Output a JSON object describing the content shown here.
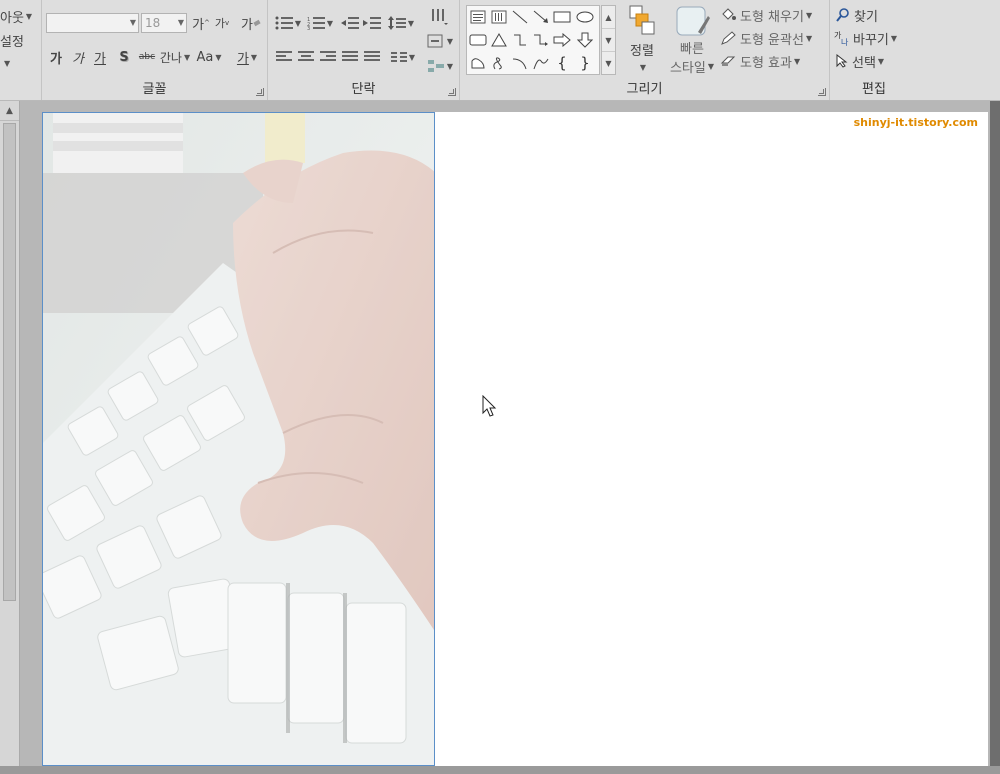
{
  "slides_group": {
    "layout_label": "아웃",
    "reset_label": "설정"
  },
  "font_group": {
    "label": "글꼴",
    "font_name": "",
    "font_size": "18",
    "grow_label": "가",
    "shrink_label": "가",
    "clear_label": "가",
    "bold_label": "가",
    "italic_label": "가",
    "underline_label": "가",
    "shadow_label": "S",
    "strike_label": "abc",
    "spacing_label": "간나",
    "case_label": "Aa",
    "color_label": "가"
  },
  "paragraph_group": {
    "label": "단락"
  },
  "drawing_group": {
    "label": "그리기",
    "arrange_label": "정렬",
    "quick_styles_line1": "빠른",
    "quick_styles_line2": "스타일",
    "shape_fill_label": "도형 채우기",
    "shape_outline_label": "도형 윤곽선",
    "shape_effects_label": "도형 효과"
  },
  "editing_group": {
    "label": "편집",
    "find_label": "찾기",
    "replace_label": "바꾸기",
    "select_label": "선택"
  },
  "slide": {
    "watermark": "shinyj-it.tistory.com"
  },
  "colors": {
    "ribbon_bg": "#dedede",
    "accent_orange": "#e08a00",
    "selection_blue": "#5b8fc8"
  }
}
